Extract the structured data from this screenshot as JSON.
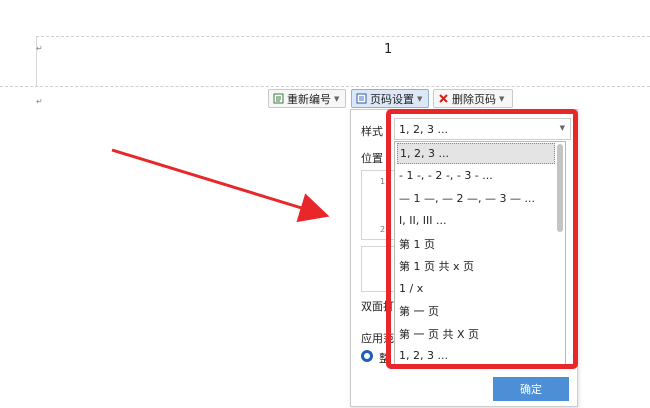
{
  "document": {
    "page_number": "1",
    "para_mark": "↵"
  },
  "toolbar": {
    "renumber_label": "重新编号",
    "page_number_settings_label": "页码设置",
    "delete_page_number_label": "删除页码"
  },
  "panel": {
    "style_label": "样式",
    "position_label": "位置",
    "double_sided_label": "双面打",
    "apply_to_label": "应用范",
    "apply_radio_label": "整",
    "ok_label": "确定",
    "preview_mark_top": "1",
    "preview_mark_mid": "2"
  },
  "style_select": {
    "value": "1, 2, 3 ..."
  },
  "style_options": [
    "1, 2, 3 ...",
    "- 1 -, - 2 -, - 3 - ...",
    "— 1 —, — 2 —, — 3 — ...",
    "I, II, III ...",
    "第 1 页",
    "第 1 页 共 x 页",
    "1 / x",
    "第 一 页",
    "第 一 页 共 X 页",
    "1, 2, 3 ..."
  ],
  "colors": {
    "annotation_red": "#e8272a",
    "accent_blue": "#4d8fd6"
  }
}
